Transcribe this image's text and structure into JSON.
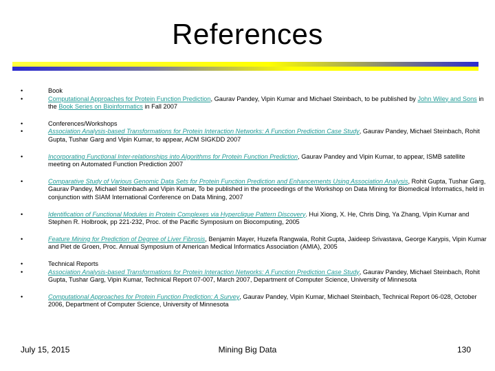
{
  "slide": {
    "title": "References",
    "bullet_glyph": "•"
  },
  "sections": [
    {
      "heading": "Book",
      "link": "Computational Approaches for Protein Function Prediction",
      "text": ", Gaurav Pandey, Vipin Kumar and Michael Steinbach, to be published by ",
      "link2": "John Wiley and Sons",
      "text2": " in the ",
      "link3": "Book Series on Bioinformatics",
      "text3": " in Fall 2007"
    },
    {
      "heading": "Conferences/Workshops",
      "link": "Association Analysis-based Transformations for Protein Interaction Networks: A Function Prediction Case Study",
      "text": ", Gaurav Pandey, Michael Steinbach, Rohit Gupta, Tushar Garg and Vipin Kumar, to appear, ACM SIGKDD 2007"
    }
  ],
  "references": [
    {
      "link": "Incorporating Functional Inter-relationships into Algorithms for Protein Function Prediction",
      "text": ", Gaurav Pandey and Vipin Kumar, to appear, ISMB satellite meeting on Automated Function Prediction 2007"
    },
    {
      "link": "Comparative Study of Various Genomic Data Sets for Protein Function Prediction and Enhancements Using Association Analysis",
      "text": ", Rohit Gupta, Tushar Garg, Gaurav Pandey, Michael Steinbach and Vipin Kumar, To be published in the proceedings of the Workshop on Data Mining for Biomedical Informatics, held in conjunction with SIAM International Conference on Data Mining, 2007"
    },
    {
      "link": "Identification of Functional Modules in Protein Complexes via Hyperclique Pattern Discovery",
      "text": ". Hui Xiong, X. He, Chris Ding, Ya Zhang, Vipin Kumar and Stephen R. Holbrook, pp 221-232, Proc. of the Pacific Symposium on Biocomputing, 2005"
    },
    {
      "link": "Feature Mining for Prediction of Degree of Liver Fibrosis",
      "text": ", Benjamin Mayer, Huzefa Rangwala, Rohit Gupta, Jaideep Srivastava, George Karypis, Vipin Kumar and Piet de Groen, Proc. Annual Symposium of American Medical Informatics Association (AMIA), 2005"
    }
  ],
  "tech_reports": {
    "heading": "Technical Reports",
    "items": [
      {
        "link": "Association Analysis-based Transformations for Protein Interaction Networks: A Function Prediction Case Study",
        "text": ", Gaurav Pandey, Michael Steinbach, Rohit Gupta, Tushar Garg, Vipin Kumar, Technical Report 07-007, March 2007, Department of Computer Science, University of Minnesota"
      },
      {
        "link": "Computational Approaches for Protein Function Prediction: A Survey",
        "text": ", Gaurav Pandey, Vipin Kumar, Michael Steinbach, Technical Report 06-028, October 2006, Department of Computer Science, University of Minnesota"
      }
    ]
  },
  "footer": {
    "date": "July 15, 2015",
    "center": "Mining Big Data",
    "page": "130"
  },
  "colors": {
    "link": "#1f9a96",
    "rule_yellow": "#ffff00",
    "rule_blue": "#2020c8"
  }
}
